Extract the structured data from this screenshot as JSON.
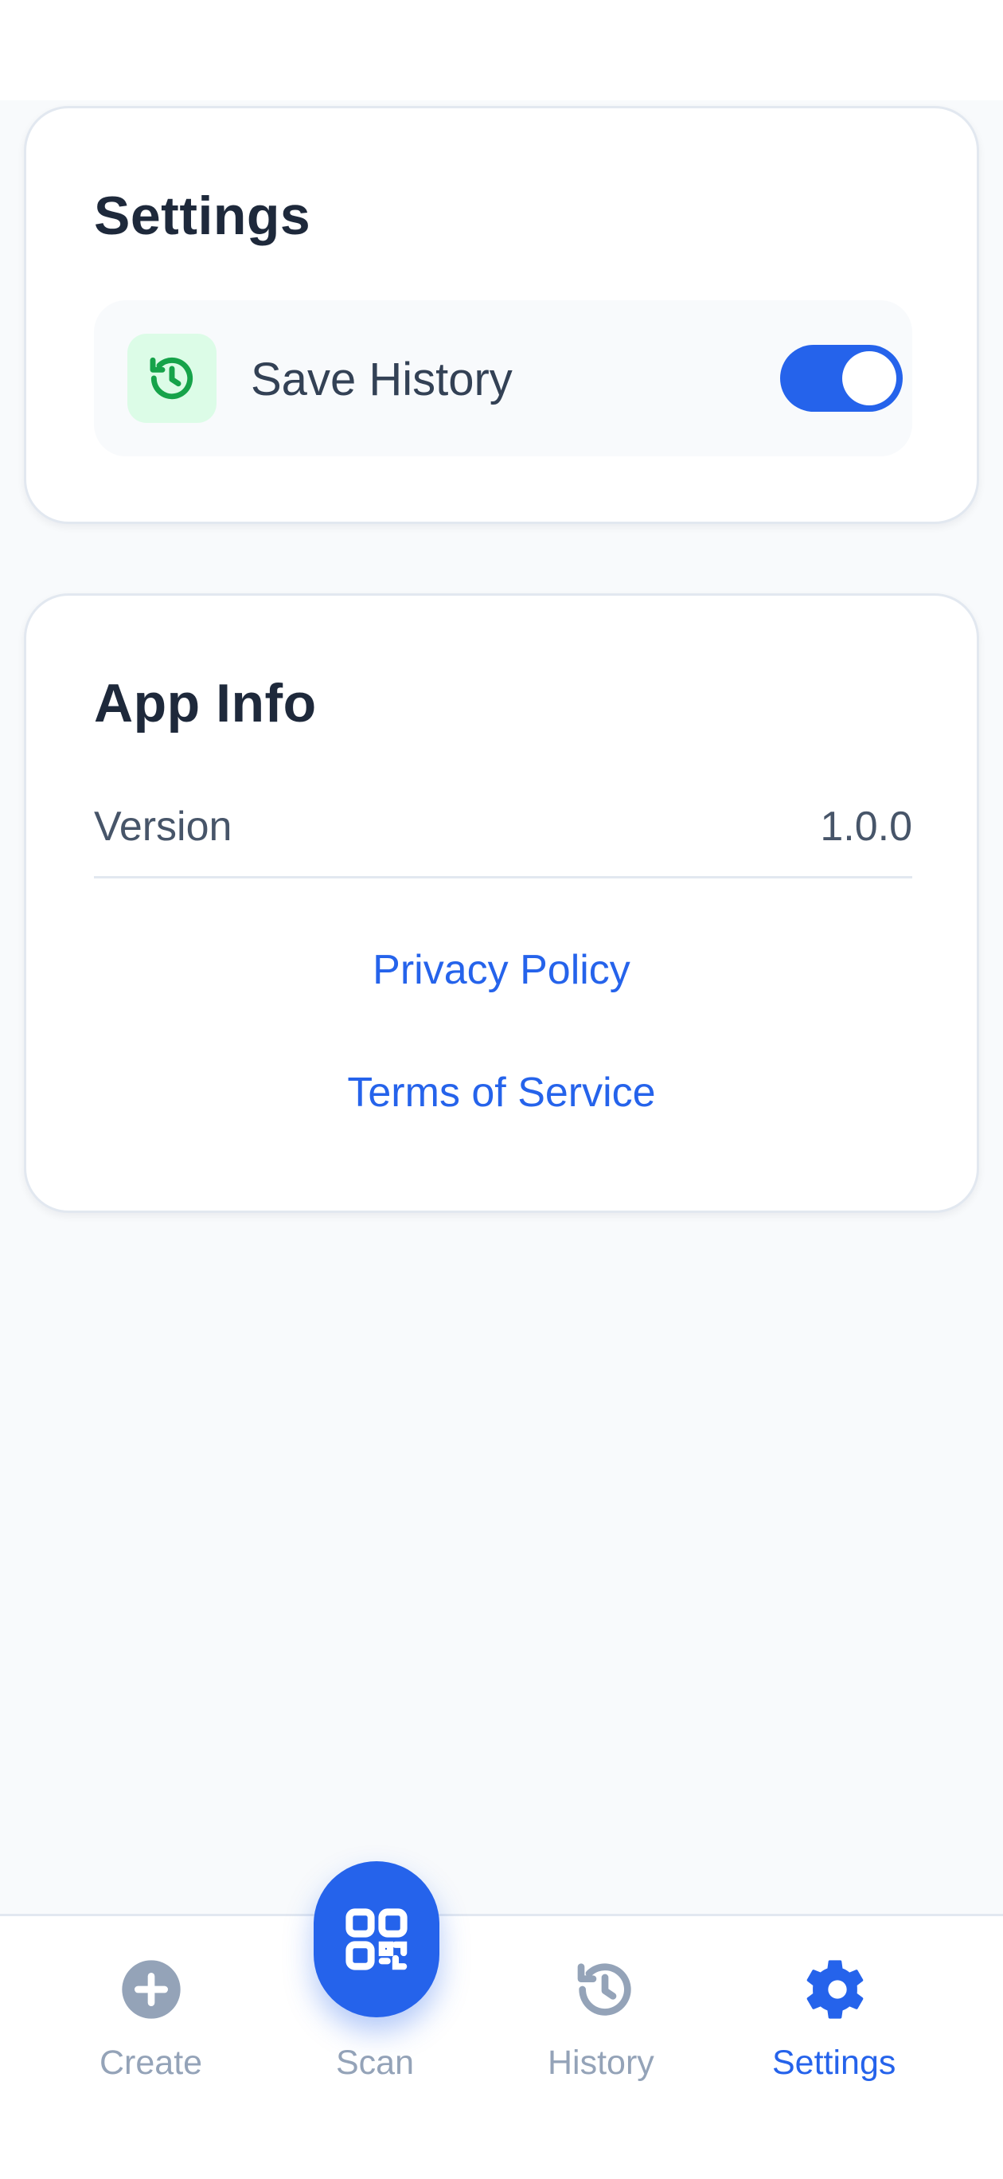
{
  "settings_card": {
    "title": "Settings",
    "save_history": {
      "label": "Save History",
      "icon": "history-icon",
      "enabled": true
    }
  },
  "app_info_card": {
    "title": "App Info",
    "version_label": "Version",
    "version_value": "1.0.0",
    "privacy_link": "Privacy Policy",
    "terms_link": "Terms of Service"
  },
  "bottom_nav": {
    "items": [
      {
        "label": "Create",
        "icon": "plus-circle-icon",
        "active": false
      },
      {
        "label": "Scan",
        "icon": "qr-code-icon",
        "active": false
      },
      {
        "label": "History",
        "icon": "history-icon",
        "active": false
      },
      {
        "label": "Settings",
        "icon": "gear-icon",
        "active": true
      }
    ]
  },
  "colors": {
    "accent": "#2563eb",
    "inactive": "#94a3b8",
    "history_icon": "#16a34a",
    "history_icon_bg": "#dcfce7"
  }
}
